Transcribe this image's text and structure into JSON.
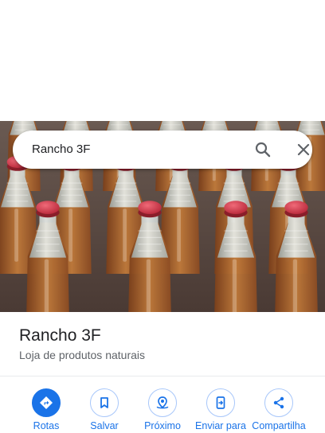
{
  "search": {
    "query": "Rancho 3F"
  },
  "place": {
    "name": "Rancho 3F",
    "category": "Loja de produtos naturais"
  },
  "actions": [
    {
      "label": "Rotas",
      "icon": "directions-icon",
      "primary": true
    },
    {
      "label": "Salvar",
      "icon": "bookmark-icon",
      "primary": false
    },
    {
      "label": "Próximo",
      "icon": "nearby-icon",
      "primary": false
    },
    {
      "label": "Enviar para",
      "icon": "send-to-phone-icon",
      "primary": false
    },
    {
      "label": "Compartilha",
      "icon": "share-icon",
      "primary": false
    }
  ],
  "colors": {
    "accent": "#1a73e8",
    "caps": "#d93848",
    "glass": "#c9cdcb",
    "juice": "#b06a2a"
  }
}
